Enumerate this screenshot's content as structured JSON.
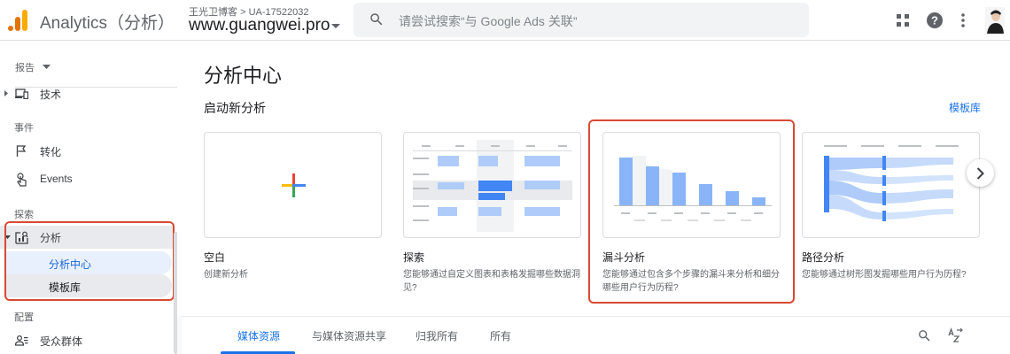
{
  "topbar": {
    "app_title": "Analytics（分析）",
    "account_name": "王光卫博客",
    "breadcrumb_separator": ">",
    "account_id": "UA-17522032",
    "property_name": "www.guangwei.pro",
    "search_placeholder": "请尝试搜索“与 Google Ads 关联”",
    "icons": [
      "apps-grid-icon",
      "help-icon",
      "more-vert-icon",
      "avatar"
    ]
  },
  "sidebar": {
    "dropdown_label": "报告",
    "items": [
      {
        "label": "技术",
        "icon": "devices-icon"
      },
      {
        "section": "事件"
      },
      {
        "label": "转化",
        "icon": "flag-icon"
      },
      {
        "label": "Events",
        "icon": "touch-icon"
      },
      {
        "section": "探索"
      },
      {
        "label": "分析",
        "icon": "analysis-icon"
      },
      {
        "label": "分析中心",
        "selected": true
      },
      {
        "label": "模板库"
      },
      {
        "section": "配置"
      },
      {
        "label": "受众群体",
        "icon": "audience-icon"
      }
    ]
  },
  "main": {
    "title": "分析中心",
    "section_label": "启动新分析",
    "gallery_link": "模板库",
    "cards": [
      {
        "title": "空白",
        "desc": "创建新分析"
      },
      {
        "title": "探索",
        "desc": "您能够通过自定义图表和表格发掘哪些数据洞见?"
      },
      {
        "title": "漏斗分析",
        "desc": "您能够通过包含多个步骤的漏斗来分析和细分哪些用户行为历程?"
      },
      {
        "title": "路径分析",
        "desc": "您能够通过树形图发掘哪些用户行为历程?"
      }
    ],
    "tabs": [
      "媒体资源",
      "与媒体资源共享",
      "归我所有",
      "所有"
    ],
    "active_tab": 0
  },
  "colors": {
    "accent": "#1a73e8",
    "highlight_border": "#d94a32",
    "selected_bg": "#e8f0fe",
    "hover_bg": "#e8eaed"
  }
}
